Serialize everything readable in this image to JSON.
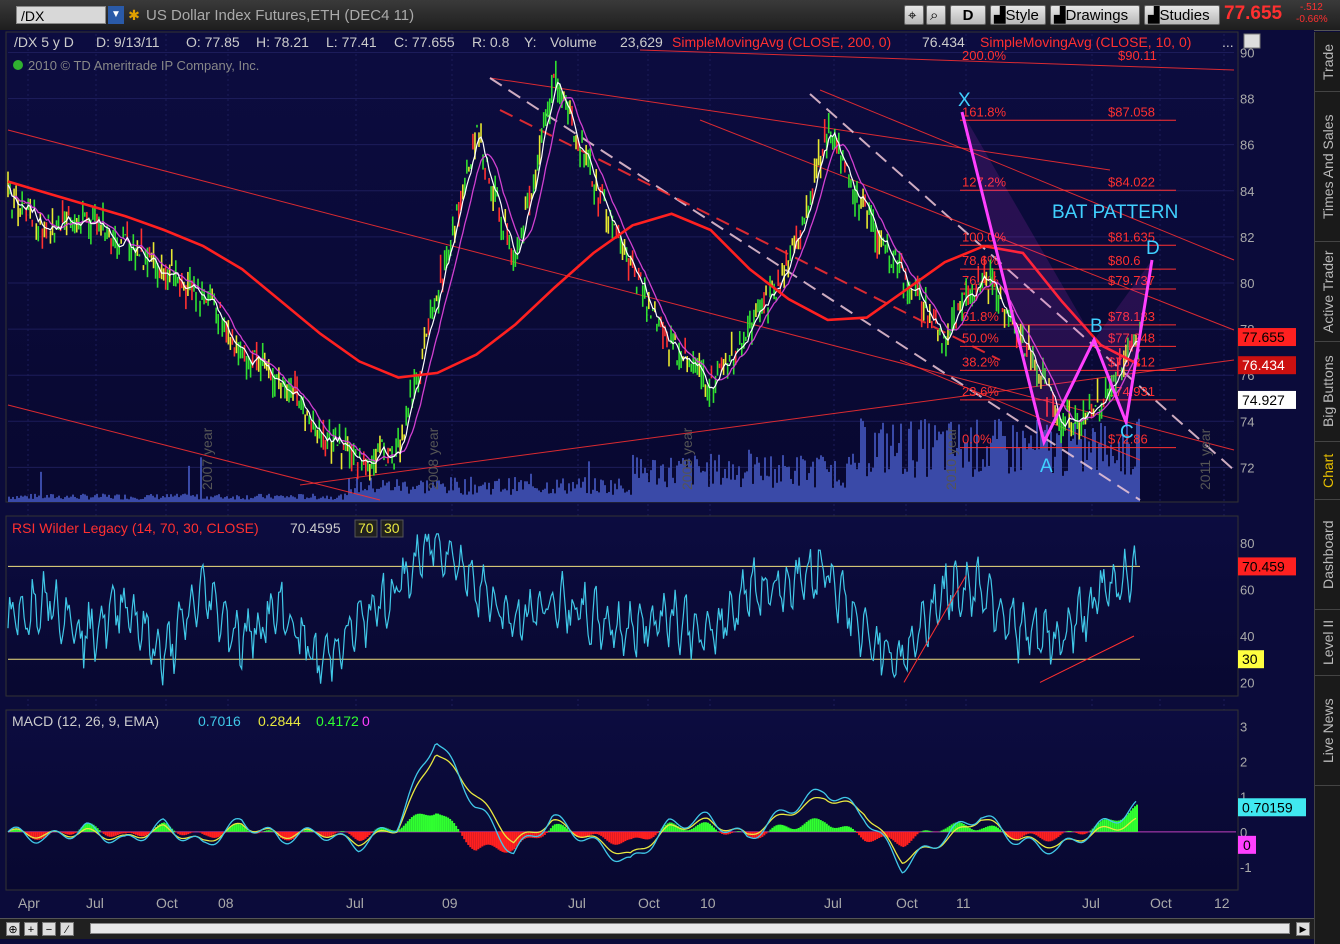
{
  "toolbar": {
    "symbol": "/DX",
    "title": "US Dollar Index Futures,ETH (DEC4 11)",
    "period_btn": "D",
    "style_btn": "Style",
    "drawings_btn": "Drawings",
    "studies_btn": "Studies",
    "last_price": "77.655",
    "change_abs": "-.512",
    "change_pct": "-0.66%"
  },
  "sidebar": {
    "tabs": [
      {
        "label": "Trade",
        "active": false
      },
      {
        "label": "Times And Sales",
        "active": false
      },
      {
        "label": "Active Trader",
        "active": false
      },
      {
        "label": "Big Buttons",
        "active": false
      },
      {
        "label": "Chart",
        "active": true
      },
      {
        "label": "Dashboard",
        "active": false
      },
      {
        "label": "Level II",
        "active": false
      },
      {
        "label": "Live News",
        "active": false
      }
    ]
  },
  "price_panel": {
    "header": {
      "symbol": "/DX 5 y D",
      "date": "D: 9/13/11",
      "open": "O: 77.85",
      "high": "H: 78.21",
      "low": "L: 77.41",
      "close": "C: 77.655",
      "range": "R: 0.8",
      "y": "Y:",
      "volume_label": "Volume",
      "volume": "23,629",
      "sma200": "SimpleMovingAvg (CLOSE, 200, 0)",
      "sma200_val": "76.434",
      "sma10": "SimpleMovingAvg (CLOSE, 10, 0)",
      "more": "..."
    },
    "copyright": "2010 © TD Ameritrade IP Company, Inc.",
    "pattern_title": "BAT PATTERN",
    "points": {
      "X": "X",
      "A": "A",
      "B": "B",
      "C": "C",
      "D": "D"
    },
    "year_labels": [
      "2007 year",
      "2008 year",
      "2009 year",
      "2010 year",
      "2011 year"
    ],
    "price_ticks": [
      "90",
      "88",
      "86",
      "84",
      "82",
      "80",
      "78",
      "76",
      "74",
      "72"
    ],
    "price_tags": {
      "last": "77.655",
      "sma200": "76.434",
      "cursor": "74.927"
    },
    "fib_levels": [
      {
        "pct": "161.8%",
        "price": "$87.058",
        "value": 87.058
      },
      {
        "pct": "127.2%",
        "price": "$84.022",
        "value": 84.022
      },
      {
        "pct": "100.0%",
        "price": "$81.635",
        "value": 81.635
      },
      {
        "pct": "78.6%",
        "price": "$80.6",
        "value": 80.6
      },
      {
        "pct": "76.4%",
        "price": "$79.737",
        "value": 79.737
      },
      {
        "pct": "61.8%",
        "price": "$78.183",
        "value": 78.183
      },
      {
        "pct": "50.0%",
        "price": "$77.248",
        "value": 77.248
      },
      {
        "pct": "38.2%",
        "price": "$76.212",
        "value": 76.212
      },
      {
        "pct": "23.6%",
        "price": "$74.931",
        "value": 74.931
      },
      {
        "pct": "0.0%",
        "price": "$72.86",
        "value": 72.86
      }
    ],
    "fib_partial_top": {
      "pct": "200.0%",
      "price": "$90.11"
    }
  },
  "rsi_panel": {
    "label": "RSI Wilder Legacy (14, 70, 30, CLOSE)",
    "value": "70.4595",
    "ob": "70",
    "os": "30",
    "ticks": [
      "80",
      "60",
      "40",
      "20"
    ],
    "tag_value": "70.459",
    "tag_os": "30"
  },
  "macd_panel": {
    "label": "MACD (12, 26, 9, EMA)",
    "macd": "0.7016",
    "signal": "0.2844",
    "hist": "0.4172",
    "zero": "0",
    "ticks": [
      "3",
      "2",
      "1",
      "0",
      "-1"
    ],
    "tag_value": "0.70159",
    "tag_zero": "0"
  },
  "x_axis": {
    "labels": [
      "Apr",
      "Jul",
      "Oct",
      "08",
      "Jul",
      "09",
      "Jul",
      "Oct",
      "10",
      "Jul",
      "Oct",
      "11",
      "Jul",
      "Oct",
      "12"
    ]
  },
  "colors": {
    "background": "#0b0b3a",
    "sma200": "#ff2020",
    "sma10": "#ffffff",
    "sma_mid": "#d040d0",
    "pattern": "#ff40ff",
    "fib": "#ff3030",
    "rsi": "#40c8e8",
    "macd": "#40c8e8",
    "signal": "#e8e840",
    "hist_pos": "#30ff30",
    "hist_neg": "#ff2020",
    "volume": "#3a4aa8"
  },
  "chart_data": [
    {
      "type": "line",
      "title": "US Dollar Index Futures,ETH (DEC4 11)",
      "ylabel": "",
      "ylim": [
        70.5,
        90.8
      ],
      "x": [
        "2006-11",
        "2007-01",
        "2007-03",
        "2007-05",
        "2007-07",
        "2007-09",
        "2007-11",
        "2008-01",
        "2008-03",
        "2008-05",
        "2008-07",
        "2008-09",
        "2008-11",
        "2009-01",
        "2009-03",
        "2009-05",
        "2009-07",
        "2009-09",
        "2009-11",
        "2010-01",
        "2010-03",
        "2010-05",
        "2010-07",
        "2010-09",
        "2010-11",
        "2011-01",
        "2011-03",
        "2011-05",
        "2011-07",
        "2011-09"
      ],
      "series": [
        {
          "name": "close",
          "values": [
            83.8,
            82.5,
            82.8,
            81.7,
            80.6,
            79.5,
            77.0,
            75.8,
            73.5,
            72.4,
            72.7,
            79.5,
            86.6,
            80.8,
            88.7,
            84.5,
            80.5,
            77.3,
            75.6,
            77.9,
            80.7,
            86.5,
            83.0,
            80.2,
            77.5,
            80.6,
            77.5,
            74.0,
            74.8,
            77.655
          ]
        },
        {
          "name": "SimpleMovingAvg (CLOSE, 200, 0)",
          "values": [
            84.4,
            83.9,
            83.4,
            82.9,
            82.3,
            81.6,
            80.6,
            79.2,
            77.8,
            76.6,
            75.9,
            76.1,
            76.9,
            78.2,
            79.8,
            81.3,
            82.5,
            83.0,
            82.3,
            80.6,
            79.3,
            78.4,
            78.5,
            79.7,
            80.9,
            81.6,
            81.3,
            79.2,
            77.3,
            76.434
          ]
        }
      ]
    },
    {
      "type": "line",
      "title": "RSI Wilder Legacy (14, 70, 30, CLOSE)",
      "ylim": [
        15,
        90
      ],
      "series": [
        {
          "name": "RSI",
          "values": [
            45,
            58,
            40,
            55,
            30,
            60,
            38,
            52,
            28,
            45,
            60,
            82,
            64,
            45,
            55,
            48,
            42,
            50,
            38,
            60,
            62,
            70,
            40,
            30,
            58,
            62,
            42,
            38,
            56,
            70.46
          ]
        }
      ]
    },
    {
      "type": "bar",
      "title": "MACD (12, 26, 9, EMA)",
      "ylim": [
        -1.6,
        3.3
      ],
      "series": [
        {
          "name": "MACD",
          "values": [
            0.0,
            -0.2,
            0.1,
            -0.3,
            0.2,
            -0.4,
            0.3,
            -0.2,
            0.0,
            -0.4,
            0.2,
            2.7,
            0.8,
            -0.6,
            0.4,
            -0.3,
            -0.9,
            0.2,
            0.4,
            -0.2,
            0.6,
            1.2,
            0.5,
            -1.0,
            -0.2,
            0.5,
            -0.3,
            -0.5,
            0.1,
            0.7016
          ]
        },
        {
          "name": "Signal",
          "values": [
            0.0,
            -0.1,
            0.0,
            -0.2,
            0.1,
            -0.3,
            0.2,
            -0.1,
            0.0,
            -0.3,
            0.1,
            2.3,
            1.1,
            -0.3,
            0.3,
            -0.2,
            -0.7,
            0.1,
            0.3,
            -0.1,
            0.5,
            1.0,
            0.6,
            -0.8,
            -0.3,
            0.4,
            -0.2,
            -0.4,
            0.0,
            0.2844
          ]
        }
      ]
    }
  ]
}
